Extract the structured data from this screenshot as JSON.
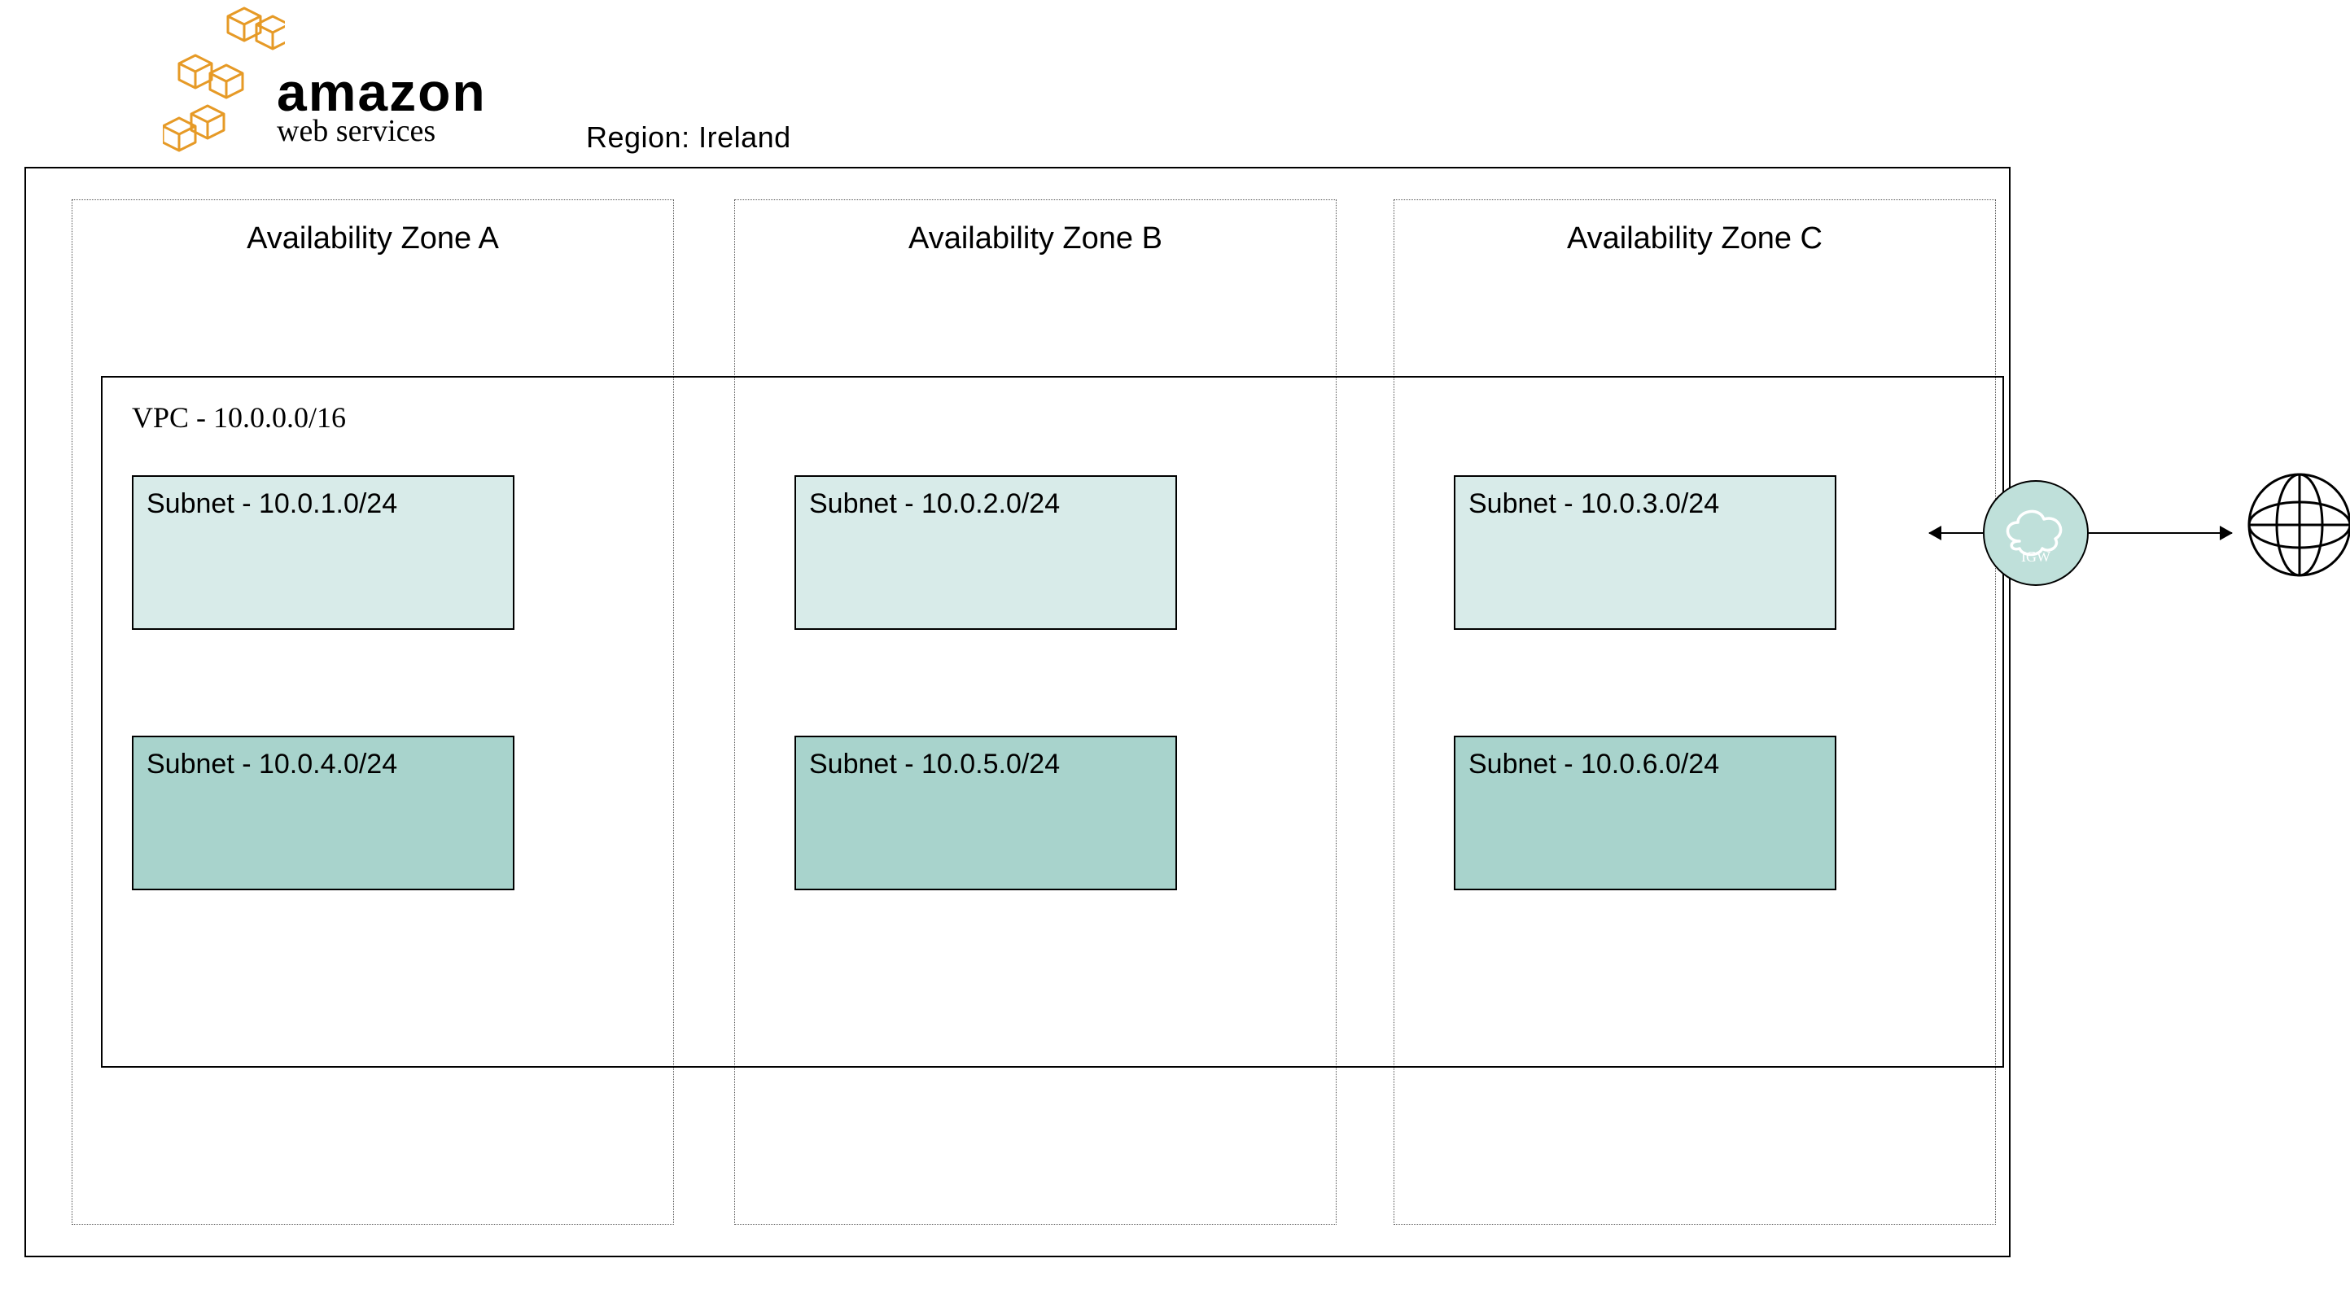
{
  "header": {
    "brand_line1": "amazon",
    "brand_line2": "web services",
    "region_label": "Region: Ireland"
  },
  "vpc": {
    "label": "VPC - 10.0.0.0/16"
  },
  "availability_zones": [
    {
      "key": "A",
      "label": "Availability Zone A"
    },
    {
      "key": "B",
      "label": "Availability Zone B"
    },
    {
      "key": "C",
      "label": "Availability Zone C"
    }
  ],
  "subnets": {
    "row1": [
      "Subnet - 10.0.1.0/24",
      "Subnet - 10.0.2.0/24",
      "Subnet - 10.0.3.0/24"
    ],
    "row2": [
      "Subnet - 10.0.4.0/24",
      "Subnet - 10.0.5.0/24",
      "Subnet - 10.0.6.0/24"
    ]
  },
  "igw": {
    "label": "IGW"
  },
  "icons": {
    "globe": "globe-icon",
    "cloud": "cloud-icon",
    "cubes": "aws-cubes-icon"
  }
}
